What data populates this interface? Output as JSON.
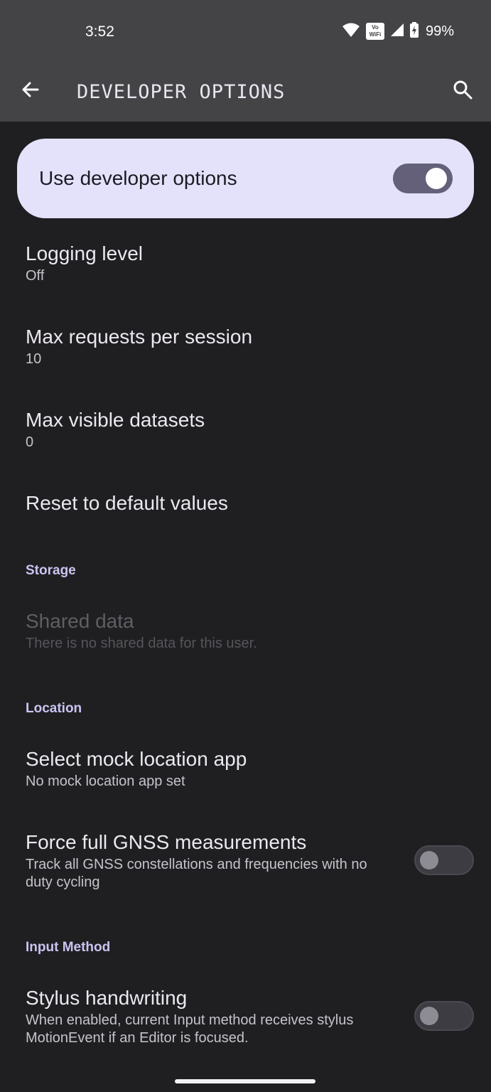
{
  "status": {
    "time": "3:52",
    "volte_top": "Vo",
    "volte_bottom": "WiFi",
    "battery": "99%"
  },
  "toolbar": {
    "title": "DEVELOPER OPTIONS",
    "back_icon": "arrow-back-icon",
    "search_icon": "search-icon"
  },
  "master": {
    "label": "Use developer options",
    "enabled": true
  },
  "items": {
    "logging": {
      "title": "Logging level",
      "summary": "Off"
    },
    "max_requests": {
      "title": "Max requests per session",
      "summary": "10"
    },
    "max_datasets": {
      "title": "Max visible datasets",
      "summary": "0"
    },
    "reset": {
      "title": "Reset to default values"
    },
    "shared_data": {
      "title": "Shared data",
      "summary": "There is no shared data for this user."
    },
    "mock_location": {
      "title": "Select mock location app",
      "summary": "No mock location app set"
    },
    "gnss": {
      "title": "Force full GNSS measurements",
      "summary": "Track all GNSS constellations and frequencies with no duty cycling",
      "enabled": false
    },
    "stylus": {
      "title": "Stylus handwriting",
      "summary": "When enabled, current Input method receives stylus MotionEvent if an Editor is focused.",
      "enabled": false
    }
  },
  "sections": {
    "storage": "Storage",
    "location": "Location",
    "input_method": "Input Method"
  },
  "colors": {
    "background": "#1f1f22",
    "appbar": "#444447",
    "master_card": "#e4e2fb",
    "section_header": "#cac4f1"
  }
}
